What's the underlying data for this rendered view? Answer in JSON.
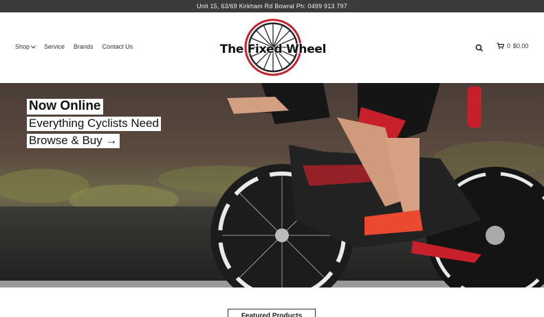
{
  "topbar": {
    "text": "Unit 15, 63/69 Kirkham Rd Bowral Ph: 0499 913 797"
  },
  "nav": {
    "shop": "Shop",
    "service": "Service",
    "brands": "Brands",
    "contact": "Contact Us"
  },
  "logo": {
    "text": "The Fixed Wheel",
    "accent": "#c8202a"
  },
  "cart": {
    "count": "0",
    "total": "$0.00"
  },
  "hero": {
    "line1": "Now Online",
    "line2": "Everything Cyclists Need",
    "line3": "Browse & Buy →"
  },
  "featured": {
    "label": "Featured Products"
  },
  "colors": {
    "topbar": "#3b3b3b",
    "brand_red": "#c8202a"
  }
}
